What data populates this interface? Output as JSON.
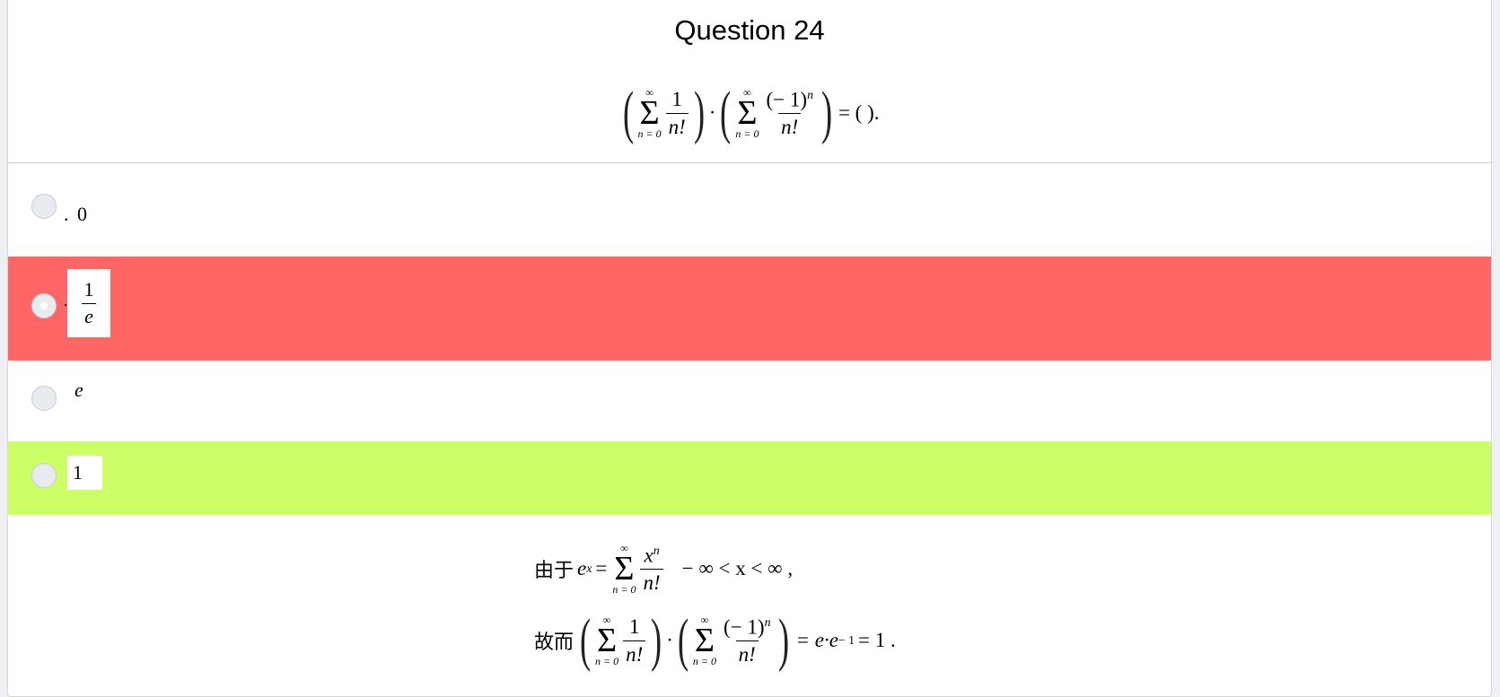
{
  "question": {
    "title": "Question 24",
    "sum_upper": "∞",
    "sum_lower": "n = 0",
    "term1_num": "1",
    "term1_den": "n!",
    "term2_num": "(− 1)",
    "term2_num_exp": "n",
    "term2_den": "n!",
    "tail": "= ( )."
  },
  "options": [
    {
      "prefix": ".",
      "value": "0",
      "selected": false,
      "state": "normal"
    },
    {
      "prefix": ".",
      "num": "1",
      "den": "e",
      "selected": true,
      "state": "incorrect"
    },
    {
      "value": "e",
      "selected": false,
      "state": "normal"
    },
    {
      "value": "1",
      "selected": false,
      "state": "correct"
    }
  ],
  "explanation": {
    "line1_prefix": "由于",
    "line1_lhs_base": "e",
    "line1_lhs_exp": "x",
    "line1_eq": "=",
    "line1_num": "x",
    "line1_num_exp": "n",
    "line1_den": "n!",
    "line1_range": "− ∞ < x < ∞ ,",
    "line2_prefix": "故而",
    "line2_result_a": "= e·e",
    "line2_result_exp": "− 1",
    "line2_result_b": "= 1 ."
  },
  "colors": {
    "incorrect": "#ff6666",
    "correct": "#ccff66",
    "radio": "#e8ecf1"
  }
}
